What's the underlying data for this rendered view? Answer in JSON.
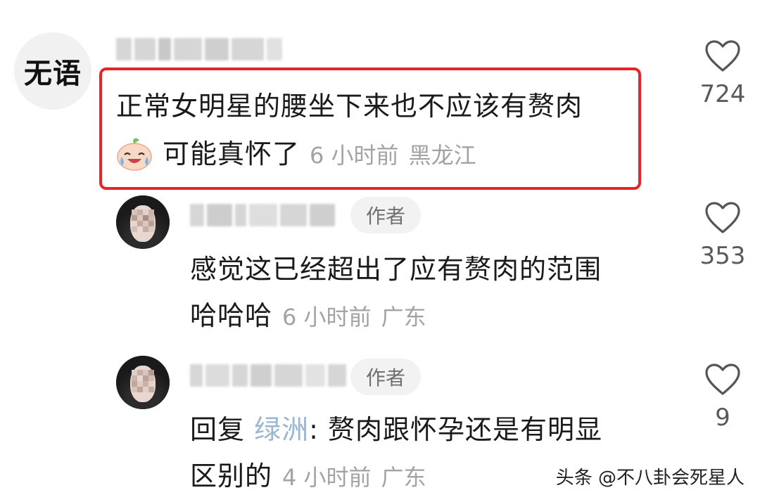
{
  "comments": [
    {
      "avatar_text": "无语",
      "line1": "正常女明星的腰坐下来也不应该有赘肉",
      "line2": "可能真怀了",
      "time": "6 小时前",
      "location": "黑龙江",
      "likes": "724",
      "emoji": "crying-laughing-emoji"
    },
    {
      "badge": "作者",
      "line1": "感觉这已经超出了应有赘肉的范围",
      "line2": "哈哈哈",
      "time": "6 小时前",
      "location": "广东",
      "likes": "353"
    },
    {
      "badge": "作者",
      "reply_prefix": "回复",
      "reply_to": "绿洲",
      "line1_rest": ": 赘肉跟怀孕还是有明显",
      "line2": "区别的",
      "time": "4 小时前",
      "location": "广东",
      "likes": "9"
    }
  ],
  "watermark": "头条 @不八卦会死星人",
  "colors": {
    "highlight_border": "#e8242b",
    "meta_text": "#a3a3a3",
    "mention_text": "#9ab6d0"
  },
  "icons": [
    "heart-outline-icon"
  ]
}
